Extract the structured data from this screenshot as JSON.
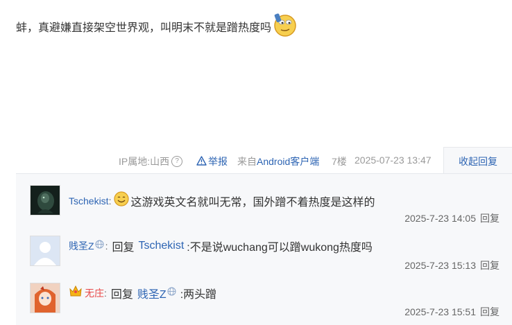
{
  "post": {
    "text": "蚌，真避嫌直接架空世界观，叫明末不就是蹭热度吗"
  },
  "meta": {
    "ip": "IP属地:山西",
    "help": "?",
    "report": "举报",
    "source": "来自Android客户端",
    "floor": "7楼",
    "time": "2025-07-23 13:47",
    "collapse": "收起回复"
  },
  "replies": [
    {
      "user": "Tschekist",
      "colon": ":",
      "content": "这游戏英文名就叫无常，国外蹭不着热度是这样的",
      "time": "2025-7-23 14:05",
      "reply": "回复"
    },
    {
      "user": "贱圣Z",
      "colon": ":",
      "reply_word": "回复",
      "target": "Tschekist",
      "content": ":不是说wuchang可以蹭wukong热度吗",
      "time": "2025-7-23 15:13",
      "reply": "回复"
    },
    {
      "user": "无庄",
      "colon": ":",
      "reply_word": "回复",
      "target": "贱圣Z",
      "content": ":两头蹭",
      "time": "2025-7-23 15:51",
      "reply": "回复"
    }
  ],
  "colors": {
    "link": "#2d64b3",
    "vip_name": "#e84747",
    "reply_bg": "#f7f8fa"
  }
}
